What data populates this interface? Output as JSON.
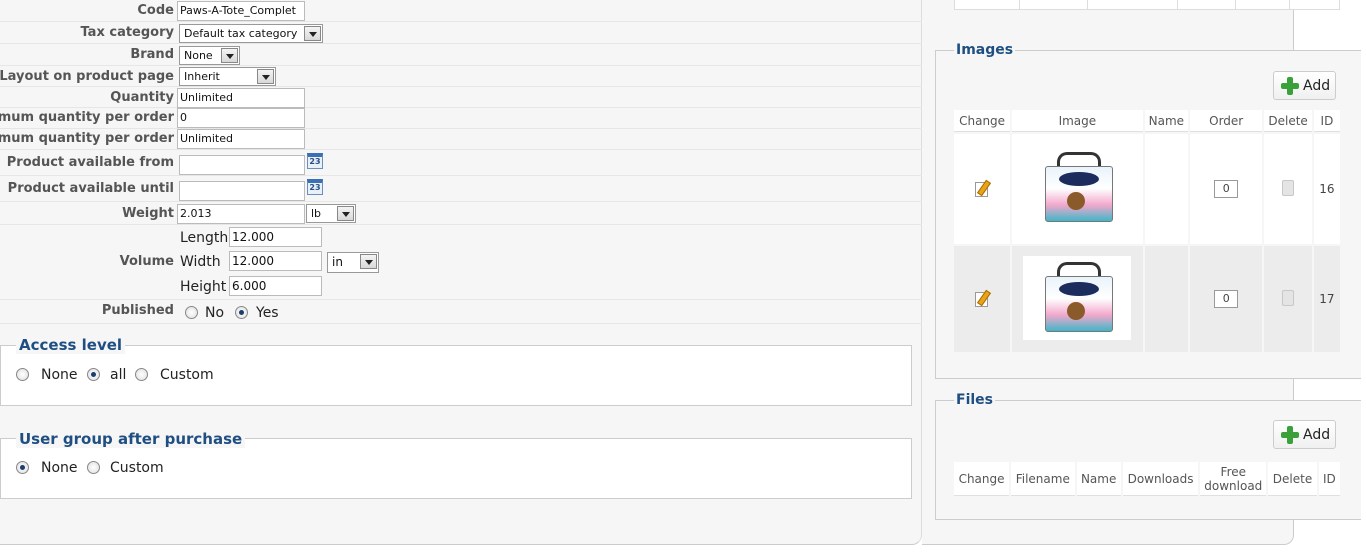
{
  "product_form": {
    "code": {
      "label": "Code",
      "value": "Paws-A-Tote_Complet"
    },
    "tax_category": {
      "label": "Tax category",
      "value": "Default tax category"
    },
    "brand": {
      "label": "Brand",
      "value": "None"
    },
    "layout": {
      "label": "Layout on product page",
      "value": "Inherit"
    },
    "quantity": {
      "label": "Quantity",
      "value": "Unlimited"
    },
    "min_qty": {
      "label": "inimum quantity per order",
      "value": "0"
    },
    "max_qty": {
      "label": "aximum quantity per order",
      "value": "Unlimited"
    },
    "available_from": {
      "label": "Product available from",
      "value": ""
    },
    "available_until": {
      "label": "Product available until",
      "value": ""
    },
    "calendar_text": "23",
    "weight": {
      "label": "Weight",
      "value": "2.013",
      "unit": "lb"
    },
    "volume": {
      "label": "Volume",
      "length_label": "Length",
      "length": "12.000",
      "width_label": "Width",
      "width": "12.000",
      "height_label": "Height",
      "height": "6.000",
      "unit": "in"
    },
    "published": {
      "label": "Published",
      "no": "No",
      "yes": "Yes",
      "selected": "Yes"
    }
  },
  "access_level": {
    "legend": "Access level",
    "options": [
      "None",
      "all",
      "Custom"
    ],
    "selected": "all"
  },
  "user_group": {
    "legend": "User group after purchase",
    "options": [
      "None",
      "Custom"
    ],
    "selected": "None"
  },
  "images": {
    "legend": "Images",
    "add_label": "Add",
    "columns": [
      "Change",
      "Image",
      "Name",
      "Order",
      "Delete",
      "ID"
    ],
    "rows": [
      {
        "order": "0",
        "id": "16",
        "name": ""
      },
      {
        "order": "0",
        "id": "17",
        "name": ""
      }
    ]
  },
  "files": {
    "legend": "Files",
    "add_label": "Add",
    "columns": [
      "Change",
      "Filename",
      "Name",
      "Downloads",
      "Free download",
      "Delete",
      "ID"
    ]
  },
  "colors": {
    "accent": "#1f4f82",
    "add_icon": "#3aa13a"
  }
}
